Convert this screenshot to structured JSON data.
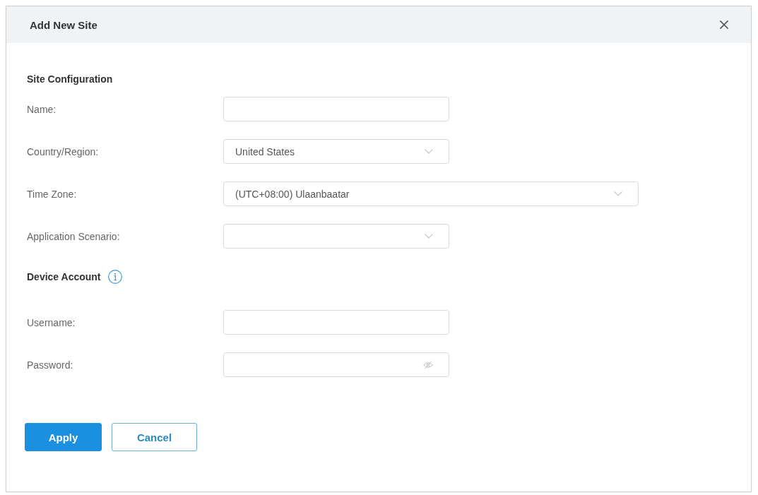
{
  "dialog": {
    "title": "Add New Site"
  },
  "sections": [
    {
      "title": "Site Configuration",
      "has_info": false,
      "fields": [
        {
          "label": "Name:",
          "kind": "text",
          "wide": false
        },
        {
          "label": "Country/Region:",
          "kind": "select",
          "value": "United States",
          "wide": false
        },
        {
          "label": "Time Zone:",
          "kind": "select",
          "value": "(UTC+08:00) Ulaanbaatar",
          "wide": true
        },
        {
          "label": "Application Scenario:",
          "kind": "select",
          "wide": false
        }
      ]
    },
    {
      "title": "Device Account",
      "has_info": true,
      "fields": [
        {
          "label": "Username:",
          "kind": "text",
          "wide": false
        },
        {
          "label": "Password:",
          "kind": "password",
          "wide": false
        }
      ]
    }
  ],
  "buttons": [
    {
      "label": "Apply",
      "kind": "primary"
    },
    {
      "label": "Cancel",
      "kind": "secondary"
    }
  ]
}
